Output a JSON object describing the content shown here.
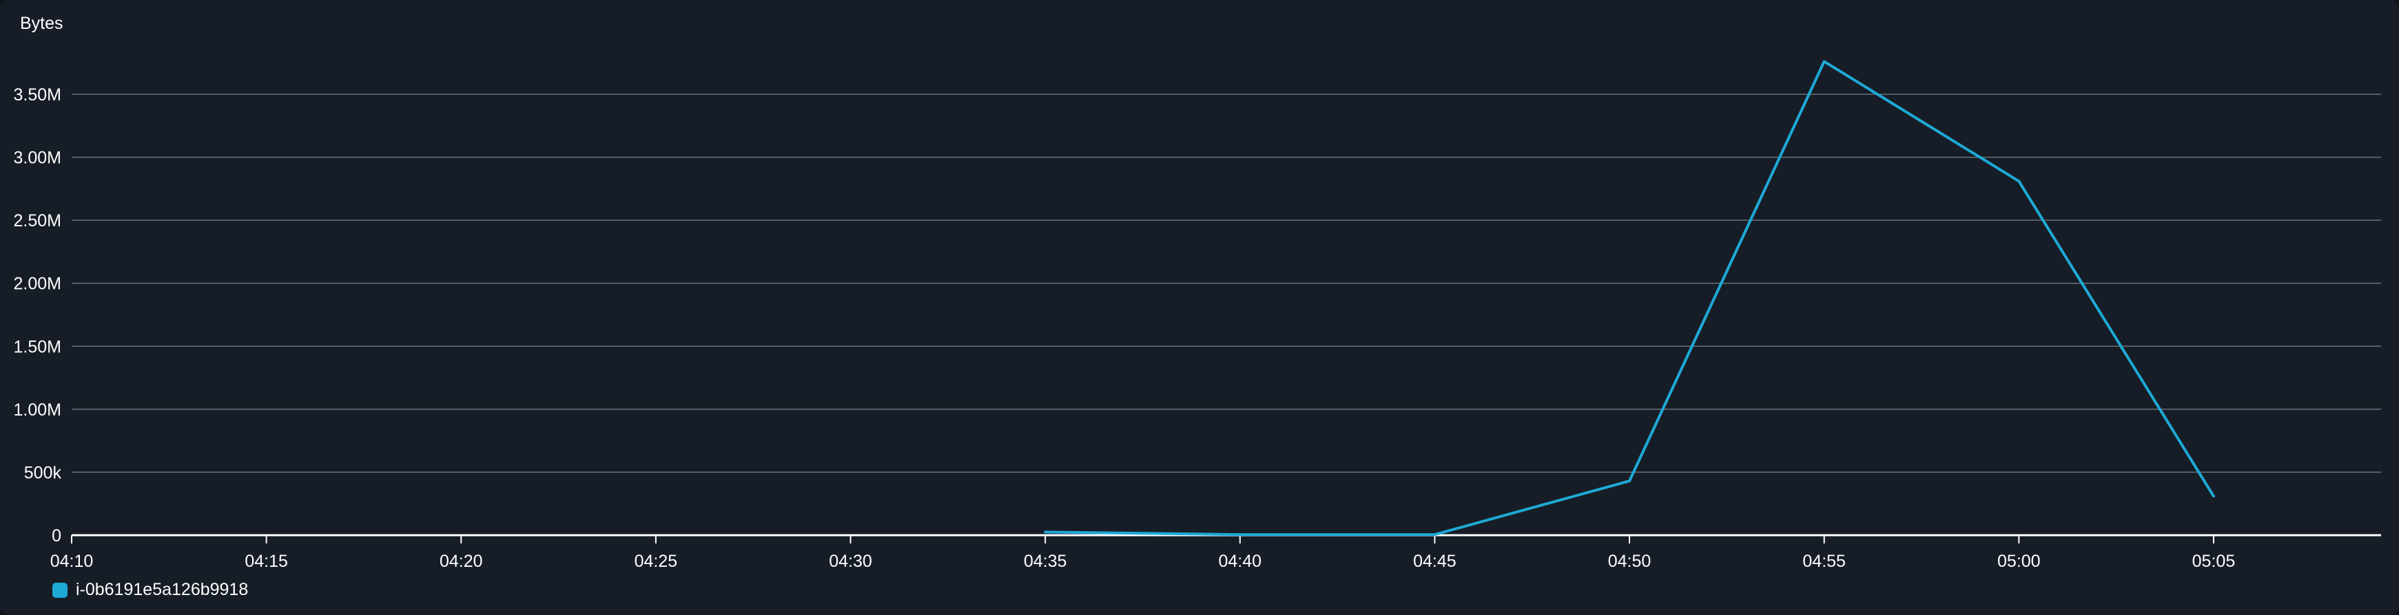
{
  "chart_data": {
    "type": "line",
    "ylabel": "Bytes",
    "yticks": [
      "0",
      "500k",
      "1.00M",
      "1.50M",
      "2.00M",
      "2.50M",
      "3.00M",
      "3.50M"
    ],
    "ytick_values": [
      0,
      500000,
      1000000,
      1500000,
      2000000,
      2500000,
      3000000,
      3500000
    ],
    "xticks": [
      "04:10",
      "04:15",
      "04:20",
      "04:25",
      "04:30",
      "04:35",
      "04:40",
      "04:45",
      "04:50",
      "04:55",
      "05:00",
      "05:05"
    ],
    "x_minutes_range": [
      250,
      309.3
    ],
    "ylim": [
      0,
      3500000
    ],
    "grid": true,
    "legend_position": "bottom-left",
    "series": [
      {
        "name": "i-0b6191e5a126b9918",
        "color": "#1ea9d5",
        "x": [
          "04:35",
          "04:40",
          "04:45",
          "04:50",
          "04:55",
          "05:00",
          "05:05"
        ],
        "values": [
          25000,
          5000,
          5000,
          430000,
          3760000,
          2810000,
          310000
        ]
      }
    ]
  },
  "colors": {
    "background": "#161d26",
    "grid": "#6c7380",
    "axis": "#ffffff",
    "text": "#ffffff"
  }
}
